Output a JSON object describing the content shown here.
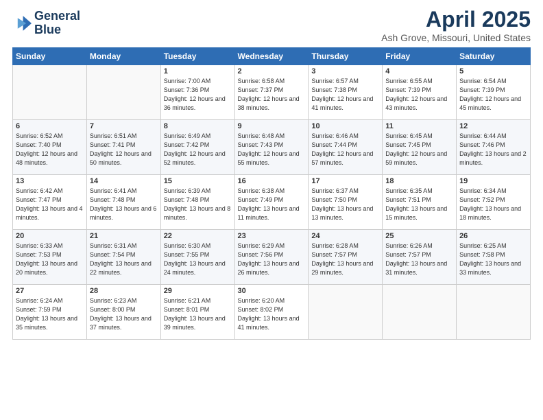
{
  "logo": {
    "line1": "General",
    "line2": "Blue"
  },
  "title": "April 2025",
  "subtitle": "Ash Grove, Missouri, United States",
  "days_of_week": [
    "Sunday",
    "Monday",
    "Tuesday",
    "Wednesday",
    "Thursday",
    "Friday",
    "Saturday"
  ],
  "weeks": [
    [
      {
        "day": "",
        "info": ""
      },
      {
        "day": "",
        "info": ""
      },
      {
        "day": "1",
        "info": "Sunrise: 7:00 AM\nSunset: 7:36 PM\nDaylight: 12 hours and 36 minutes."
      },
      {
        "day": "2",
        "info": "Sunrise: 6:58 AM\nSunset: 7:37 PM\nDaylight: 12 hours and 38 minutes."
      },
      {
        "day": "3",
        "info": "Sunrise: 6:57 AM\nSunset: 7:38 PM\nDaylight: 12 hours and 41 minutes."
      },
      {
        "day": "4",
        "info": "Sunrise: 6:55 AM\nSunset: 7:39 PM\nDaylight: 12 hours and 43 minutes."
      },
      {
        "day": "5",
        "info": "Sunrise: 6:54 AM\nSunset: 7:39 PM\nDaylight: 12 hours and 45 minutes."
      }
    ],
    [
      {
        "day": "6",
        "info": "Sunrise: 6:52 AM\nSunset: 7:40 PM\nDaylight: 12 hours and 48 minutes."
      },
      {
        "day": "7",
        "info": "Sunrise: 6:51 AM\nSunset: 7:41 PM\nDaylight: 12 hours and 50 minutes."
      },
      {
        "day": "8",
        "info": "Sunrise: 6:49 AM\nSunset: 7:42 PM\nDaylight: 12 hours and 52 minutes."
      },
      {
        "day": "9",
        "info": "Sunrise: 6:48 AM\nSunset: 7:43 PM\nDaylight: 12 hours and 55 minutes."
      },
      {
        "day": "10",
        "info": "Sunrise: 6:46 AM\nSunset: 7:44 PM\nDaylight: 12 hours and 57 minutes."
      },
      {
        "day": "11",
        "info": "Sunrise: 6:45 AM\nSunset: 7:45 PM\nDaylight: 12 hours and 59 minutes."
      },
      {
        "day": "12",
        "info": "Sunrise: 6:44 AM\nSunset: 7:46 PM\nDaylight: 13 hours and 2 minutes."
      }
    ],
    [
      {
        "day": "13",
        "info": "Sunrise: 6:42 AM\nSunset: 7:47 PM\nDaylight: 13 hours and 4 minutes."
      },
      {
        "day": "14",
        "info": "Sunrise: 6:41 AM\nSunset: 7:48 PM\nDaylight: 13 hours and 6 minutes."
      },
      {
        "day": "15",
        "info": "Sunrise: 6:39 AM\nSunset: 7:48 PM\nDaylight: 13 hours and 8 minutes."
      },
      {
        "day": "16",
        "info": "Sunrise: 6:38 AM\nSunset: 7:49 PM\nDaylight: 13 hours and 11 minutes."
      },
      {
        "day": "17",
        "info": "Sunrise: 6:37 AM\nSunset: 7:50 PM\nDaylight: 13 hours and 13 minutes."
      },
      {
        "day": "18",
        "info": "Sunrise: 6:35 AM\nSunset: 7:51 PM\nDaylight: 13 hours and 15 minutes."
      },
      {
        "day": "19",
        "info": "Sunrise: 6:34 AM\nSunset: 7:52 PM\nDaylight: 13 hours and 18 minutes."
      }
    ],
    [
      {
        "day": "20",
        "info": "Sunrise: 6:33 AM\nSunset: 7:53 PM\nDaylight: 13 hours and 20 minutes."
      },
      {
        "day": "21",
        "info": "Sunrise: 6:31 AM\nSunset: 7:54 PM\nDaylight: 13 hours and 22 minutes."
      },
      {
        "day": "22",
        "info": "Sunrise: 6:30 AM\nSunset: 7:55 PM\nDaylight: 13 hours and 24 minutes."
      },
      {
        "day": "23",
        "info": "Sunrise: 6:29 AM\nSunset: 7:56 PM\nDaylight: 13 hours and 26 minutes."
      },
      {
        "day": "24",
        "info": "Sunrise: 6:28 AM\nSunset: 7:57 PM\nDaylight: 13 hours and 29 minutes."
      },
      {
        "day": "25",
        "info": "Sunrise: 6:26 AM\nSunset: 7:57 PM\nDaylight: 13 hours and 31 minutes."
      },
      {
        "day": "26",
        "info": "Sunrise: 6:25 AM\nSunset: 7:58 PM\nDaylight: 13 hours and 33 minutes."
      }
    ],
    [
      {
        "day": "27",
        "info": "Sunrise: 6:24 AM\nSunset: 7:59 PM\nDaylight: 13 hours and 35 minutes."
      },
      {
        "day": "28",
        "info": "Sunrise: 6:23 AM\nSunset: 8:00 PM\nDaylight: 13 hours and 37 minutes."
      },
      {
        "day": "29",
        "info": "Sunrise: 6:21 AM\nSunset: 8:01 PM\nDaylight: 13 hours and 39 minutes."
      },
      {
        "day": "30",
        "info": "Sunrise: 6:20 AM\nSunset: 8:02 PM\nDaylight: 13 hours and 41 minutes."
      },
      {
        "day": "",
        "info": ""
      },
      {
        "day": "",
        "info": ""
      },
      {
        "day": "",
        "info": ""
      }
    ]
  ]
}
